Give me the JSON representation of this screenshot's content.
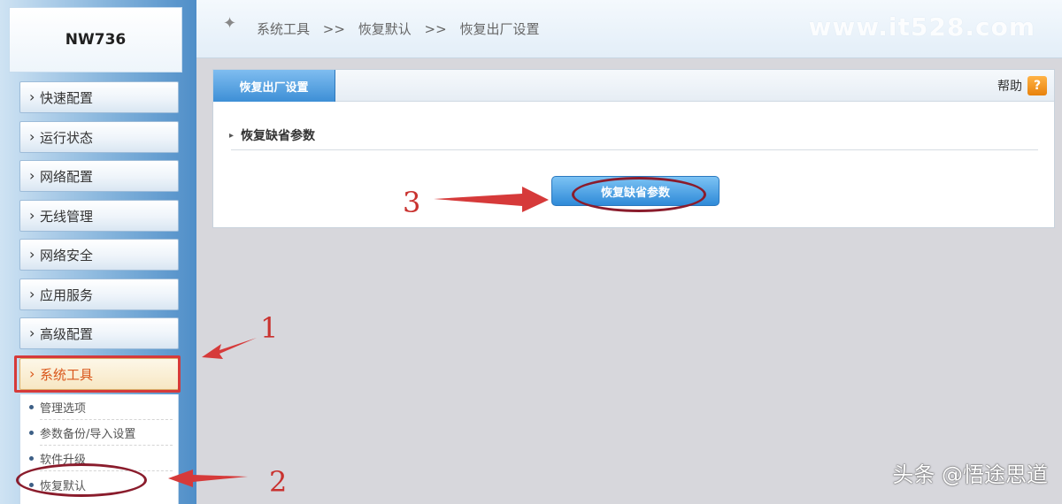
{
  "sidebar": {
    "brand": "NW736",
    "items": [
      {
        "label": "快速配置"
      },
      {
        "label": "运行状态"
      },
      {
        "label": "网络配置"
      },
      {
        "label": "无线管理"
      },
      {
        "label": "网络安全"
      },
      {
        "label": "应用服务"
      },
      {
        "label": "高级配置"
      },
      {
        "label": "系统工具"
      }
    ],
    "subitems": [
      {
        "label": "管理选项"
      },
      {
        "label": "参数备份/导入设置"
      },
      {
        "label": "软件升级"
      },
      {
        "label": "恢复默认"
      }
    ]
  },
  "header": {
    "breadcrumb": [
      "系统工具",
      ">>",
      "恢复默认",
      ">>",
      "恢复出厂设置"
    ],
    "watermark": "www.it528.com"
  },
  "panel": {
    "tab_label": "恢复出厂设置",
    "help_label": "帮助",
    "help_icon": "?",
    "section_title": "恢复缺省参数",
    "restore_button": "恢复缺省参数"
  },
  "annotations": {
    "step1": "1",
    "step2": "2",
    "step3": "3",
    "arrow_color": "#d63a3a"
  },
  "footer_watermark": "头条 @悟途思道"
}
